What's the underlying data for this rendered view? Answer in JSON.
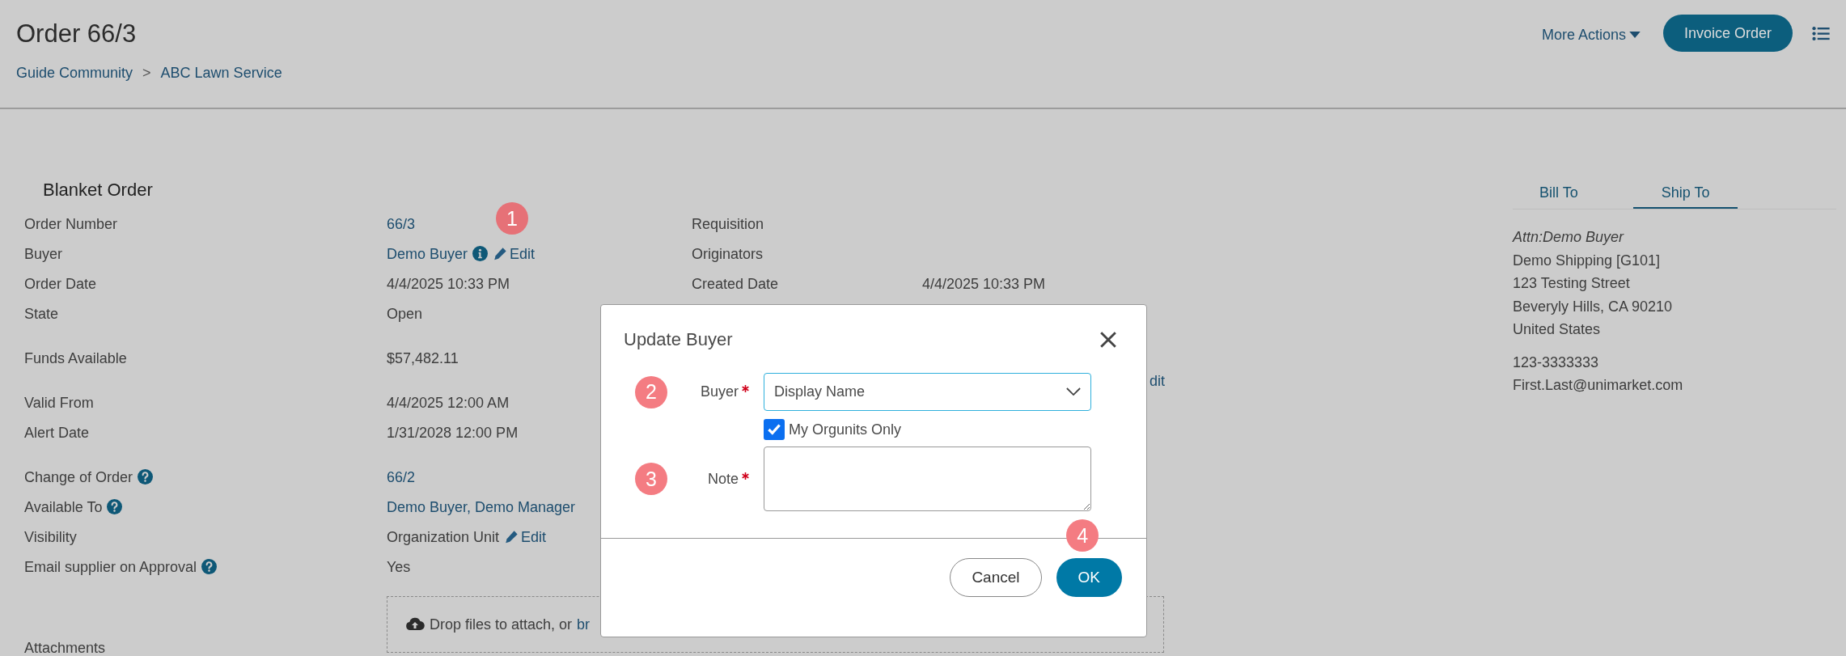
{
  "header": {
    "title": "Order 66/3",
    "breadcrumb": [
      {
        "label": "Guide Community"
      },
      {
        "label": "ABC Lawn Service"
      }
    ],
    "separator": ">",
    "more_actions": "More Actions",
    "primary_action": "Invoice Order"
  },
  "order": {
    "heading": "Blanket Order",
    "groups": [
      [
        {
          "label": "Order Number",
          "value": "66/3",
          "kind": "link"
        },
        {
          "label": "Buyer",
          "value": "Demo Buyer",
          "kind": "link",
          "info": true,
          "edit": "Edit",
          "callout": "1"
        },
        {
          "label": "Order Date",
          "value": "4/4/2025 10:33 PM",
          "kind": "text"
        },
        {
          "label": "State",
          "value": "Open",
          "kind": "text"
        }
      ],
      [
        {
          "label": "Funds Available",
          "value": "$57,482.11",
          "kind": "text"
        }
      ],
      [
        {
          "label": "Valid From",
          "value": "4/4/2025 12:00 AM",
          "kind": "text"
        },
        {
          "label": "Alert Date",
          "value": "1/31/2028 12:00 PM",
          "kind": "text"
        }
      ],
      [
        {
          "label": "Change of Order",
          "help": true,
          "value": "66/2",
          "kind": "link"
        },
        {
          "label": "Available To",
          "help": true,
          "value": "Demo Buyer, Demo Manager",
          "kind": "link"
        },
        {
          "label": "Visibility",
          "value": "Organization Unit",
          "kind": "text",
          "edit": "Edit"
        },
        {
          "label": "Email supplier on Approval",
          "help": true,
          "value": "Yes",
          "kind": "text"
        }
      ],
      [
        {
          "label": "Attachments",
          "kind": "dropzone",
          "value": "Drop files to attach, or ",
          "link": "br"
        }
      ]
    ]
  },
  "details": {
    "fields": [
      {
        "label": "Requisition"
      },
      {
        "label": "Originators"
      },
      {
        "label": "Created Date",
        "value": "4/4/2025 10:33 PM"
      }
    ],
    "obscured_link": "dit"
  },
  "address": {
    "tabs": [
      {
        "label": "Bill To",
        "selected": false
      },
      {
        "label": "Ship To",
        "selected": true
      }
    ],
    "attention": "Attn:Demo Buyer",
    "lines": [
      "Demo Shipping [G101]",
      "123 Testing Street",
      "Beveryly Hills, CA 90210",
      "United States"
    ],
    "contact": [
      "123-3333333",
      "First.Last@unimarket.com"
    ]
  },
  "dialog": {
    "title": "Update Buyer",
    "buyer": {
      "label": "Buyer",
      "required": true,
      "value": "Display Name",
      "callout": "2"
    },
    "checkbox": {
      "label": "My Orgunits Only",
      "checked": true
    },
    "note": {
      "label": "Note",
      "required": true,
      "callout": "3"
    },
    "buttons": [
      {
        "label": "Cancel",
        "kind": "secondary"
      },
      {
        "label": "OK",
        "kind": "primary",
        "callout": "4"
      }
    ]
  }
}
